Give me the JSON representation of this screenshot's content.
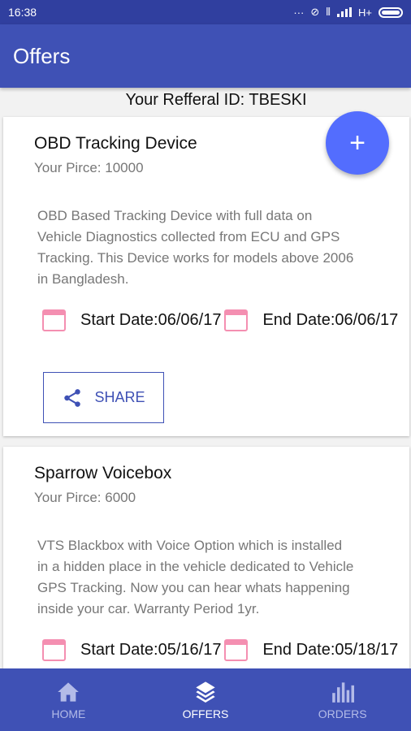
{
  "status_bar": {
    "time": "16:38",
    "network": "H+"
  },
  "app_bar": {
    "title": "Offers"
  },
  "referral": {
    "text": "Your Refferal ID: TBESKI"
  },
  "offers": [
    {
      "title": "OBD Tracking Device",
      "price": "Your Pirce: 10000",
      "description": [
        "OBD Based Tracking Device with full data on",
        "Vehicle Diagnostics collected from ECU and GPS",
        "Tracking. This Device works for models above 2006",
        "in Bangladesh."
      ],
      "start_date": "Start Date:06/06/17",
      "end_date": "End Date:06/06/17",
      "share_label": "SHARE"
    },
    {
      "title": "Sparrow Voicebox",
      "price": "Your Pirce: 6000",
      "description": [
        "VTS Blackbox with Voice Option which is installed",
        "in a hidden place in the vehicle dedicated to Vehicle",
        "GPS Tracking. Now you can hear whats happening",
        "inside your car. Warranty Period 1yr."
      ],
      "start_date": "Start Date:05/16/17",
      "end_date": "End Date:05/18/17"
    }
  ],
  "fab": {
    "label": "+"
  },
  "bottom_nav": [
    {
      "label": "HOME",
      "icon": "home-icon"
    },
    {
      "label": "OFFERS",
      "icon": "layers-icon",
      "active": true
    },
    {
      "label": "ORDERS",
      "icon": "bar-chart-icon"
    }
  ],
  "colors": {
    "primary": "#3f51b5",
    "primary_dark": "#303f9f",
    "accent": "#536dfe",
    "calendar_icon": "#f48fb1"
  }
}
